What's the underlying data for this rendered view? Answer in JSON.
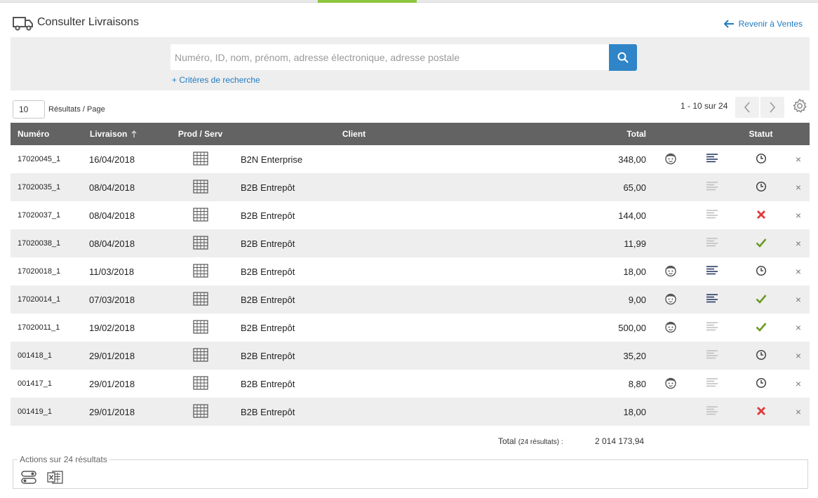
{
  "header": {
    "title": "Consulter Livraisons",
    "back_label": "Revenir à Ventes"
  },
  "search": {
    "placeholder": "Numéro, ID, nom, prénom, adresse électronique, adresse postale",
    "criteria_label": "+ Critères de recherche"
  },
  "pagination": {
    "per_page": "10",
    "per_page_label": "Résultats / Page",
    "range": "1 - 10 sur 24"
  },
  "table": {
    "columns": {
      "numero": "Numéro",
      "livraison": "Livraison",
      "prod": "Prod / Serv",
      "client": "Client",
      "total": "Total",
      "statut": "Statut"
    },
    "rows": [
      {
        "numero": "17020045_1",
        "date": "16/04/2018",
        "client": "B2N Enterprise",
        "total": "348,00",
        "face": true,
        "lines": "dark",
        "status": "pending"
      },
      {
        "numero": "17020035_1",
        "date": "08/04/2018",
        "client": "B2B Entrepôt",
        "total": "65,00",
        "face": false,
        "lines": "light",
        "status": "pending"
      },
      {
        "numero": "17020037_1",
        "date": "08/04/2018",
        "client": "B2B Entrepôt",
        "total": "144,00",
        "face": false,
        "lines": "light",
        "status": "cancelled"
      },
      {
        "numero": "17020038_1",
        "date": "08/04/2018",
        "client": "B2B Entrepôt",
        "total": "11,99",
        "face": false,
        "lines": "light",
        "status": "done"
      },
      {
        "numero": "17020018_1",
        "date": "11/03/2018",
        "client": "B2B Entrepôt",
        "total": "18,00",
        "face": true,
        "lines": "dark",
        "status": "pending"
      },
      {
        "numero": "17020014_1",
        "date": "07/03/2018",
        "client": "B2B Entrepôt",
        "total": "9,00",
        "face": true,
        "lines": "dark",
        "status": "done"
      },
      {
        "numero": "17020011_1",
        "date": "19/02/2018",
        "client": "B2B Entrepôt",
        "total": "500,00",
        "face": true,
        "lines": "light",
        "status": "done"
      },
      {
        "numero": "001418_1",
        "date": "29/01/2018",
        "client": "B2B Entrepôt",
        "total": "35,20",
        "face": false,
        "lines": "light",
        "status": "pending"
      },
      {
        "numero": "001417_1",
        "date": "29/01/2018",
        "client": "B2B Entrepôt",
        "total": "8,80",
        "face": true,
        "lines": "light",
        "status": "pending"
      },
      {
        "numero": "001419_1",
        "date": "29/01/2018",
        "client": "B2B Entrepôt",
        "total": "18,00",
        "face": false,
        "lines": "light",
        "status": "cancelled"
      }
    ]
  },
  "summary": {
    "total_label": "Total",
    "total_count": "(24 résultats) :",
    "total_value": "2 014 173,94"
  },
  "actions": {
    "title": "Actions sur 24 résultats"
  },
  "colors": {
    "accent": "#8cc63e",
    "link": "#1f7bc1",
    "search_button": "#2f85c8",
    "header_row": "#636363",
    "status_done": "#6a9a1f",
    "status_cancelled": "#e03a3a"
  }
}
